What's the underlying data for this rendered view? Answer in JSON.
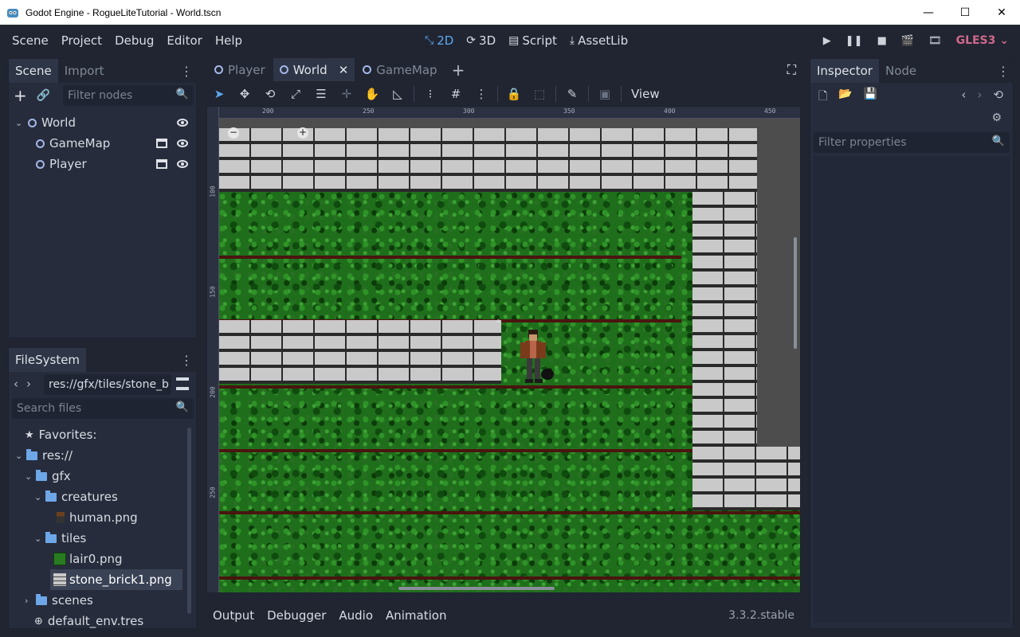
{
  "window": {
    "title": "Godot Engine - RogueLiteTutorial - World.tscn",
    "minimize": "—",
    "maximize": "☐",
    "close": "✕"
  },
  "menu": {
    "items": [
      "Scene",
      "Project",
      "Debug",
      "Editor",
      "Help"
    ]
  },
  "workspaces": {
    "d2": "2D",
    "d3": "3D",
    "script": "Script",
    "assetlib": "AssetLib"
  },
  "renderer": "GLES3",
  "scene_dock": {
    "tabs": [
      "Scene",
      "Import"
    ],
    "filter_placeholder": "Filter nodes",
    "nodes": [
      {
        "label": "World"
      },
      {
        "label": "GameMap"
      },
      {
        "label": "Player"
      }
    ]
  },
  "filesystem": {
    "tab": "FileSystem",
    "path": "res://gfx/tiles/stone_b",
    "search_placeholder": "Search files",
    "items": [
      {
        "label": "Favorites:"
      },
      {
        "label": "res://"
      },
      {
        "label": "gfx"
      },
      {
        "label": "creatures"
      },
      {
        "label": "human.png"
      },
      {
        "label": "tiles"
      },
      {
        "label": "lair0.png"
      },
      {
        "label": "stone_brick1.png"
      },
      {
        "label": "scenes"
      },
      {
        "label": "default_env.tres"
      }
    ]
  },
  "editor_tabs": [
    "Player",
    "World",
    "GameMap"
  ],
  "toolbar": {
    "view": "View"
  },
  "rulers": {
    "top": [
      "200",
      "250",
      "300",
      "350",
      "400",
      "450"
    ],
    "left": [
      "100",
      "150",
      "200",
      "250"
    ]
  },
  "inspector": {
    "tabs": [
      "Inspector",
      "Node"
    ],
    "filter_placeholder": "Filter properties"
  },
  "bottom": {
    "tabs": [
      "Output",
      "Debugger",
      "Audio",
      "Animation"
    ],
    "version": "3.3.2.stable"
  }
}
